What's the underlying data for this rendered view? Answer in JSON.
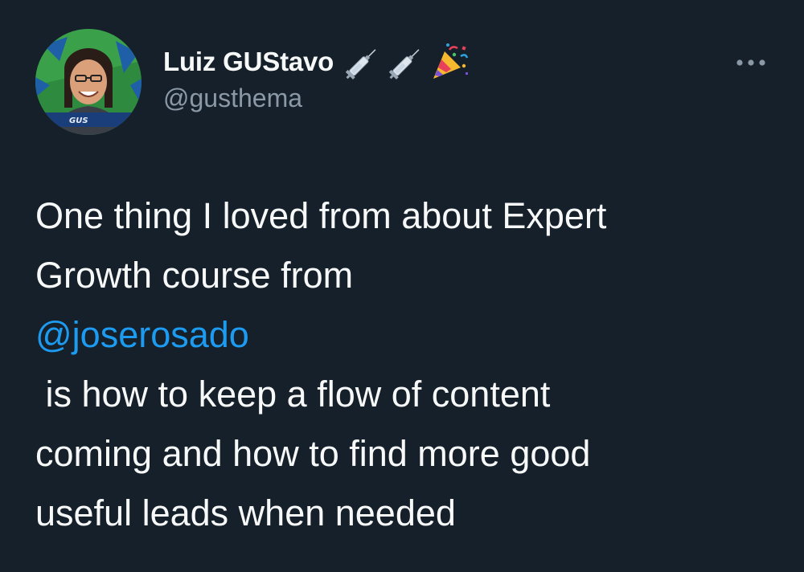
{
  "tweet": {
    "author": {
      "display_name": "Luiz GUStavo",
      "handle": "@gusthema",
      "name_emojis": [
        "syringe-icon",
        "syringe-icon",
        "party-popper-icon"
      ],
      "avatar_badge_text": "GUS"
    },
    "more_icon": "more-options-icon",
    "text": {
      "line1": "One thing I loved from about Expert",
      "line2": "Growth course from",
      "mention": "@joserosado",
      "line3": " is how to keep a flow of content",
      "line4": "coming and how to find more good",
      "line5": "useful leads when needed"
    }
  },
  "colors": {
    "background": "#15202b",
    "text_primary": "#f7f9f9",
    "text_secondary": "#8b98a5",
    "link": "#1d9bf0"
  }
}
